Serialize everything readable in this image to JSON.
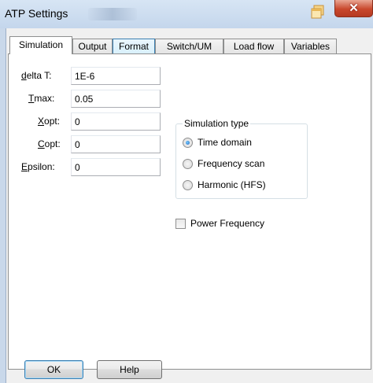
{
  "window": {
    "title": "ATP Settings",
    "title_smudge": "OND-TOP"
  },
  "tabs": [
    "Simulation",
    "Output",
    "Format",
    "Switch/UM",
    "Load flow",
    "Variables"
  ],
  "active_tab": "Simulation",
  "fields": {
    "delta_t": {
      "label_prefix": "",
      "label_accel": "d",
      "label_rest": "elta T:",
      "value": "1E-6"
    },
    "tmax": {
      "label_prefix": "",
      "label_accel": "T",
      "label_rest": "max:",
      "value": "0.05"
    },
    "xopt": {
      "label_prefix": "",
      "label_accel": "X",
      "label_rest": "opt:",
      "value": "0"
    },
    "copt": {
      "label_prefix": "",
      "label_accel": "C",
      "label_rest": "opt:",
      "value": "0"
    },
    "epsilon": {
      "label_prefix": "",
      "label_accel": "E",
      "label_rest": "psilon:",
      "value": "0"
    }
  },
  "simulation_type": {
    "title": "Simulation type",
    "options": [
      "Time domain",
      "Frequency scan",
      "Harmonic (HFS)"
    ],
    "selected": "Time domain"
  },
  "power_frequency": {
    "label": "Power Frequency",
    "checked": false
  },
  "buttons": {
    "ok": "OK",
    "help": "Help"
  },
  "colors": {
    "accent": "#3c7fb1",
    "close": "#c9482d",
    "frame": "#c9d8ea"
  }
}
